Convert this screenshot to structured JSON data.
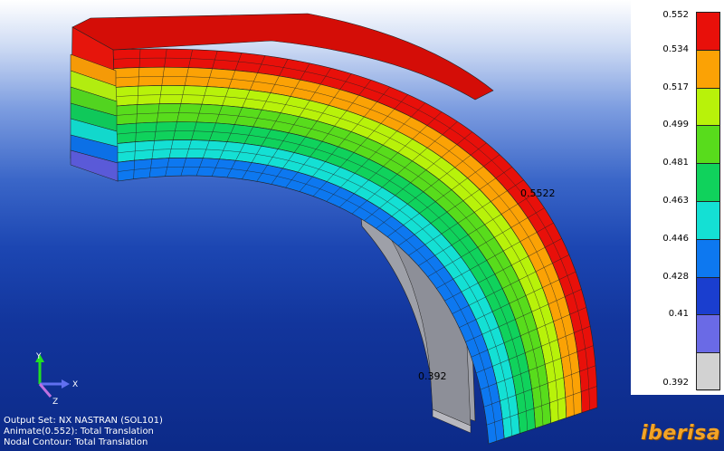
{
  "legend": {
    "values": [
      "0.552",
      "0.534",
      "0.517",
      "0.499",
      "0.481",
      "0.463",
      "0.446",
      "0.428",
      "0.41",
      "0.392"
    ],
    "colors": [
      "#e8100a",
      "#fba205",
      "#b8f20a",
      "#58dc1c",
      "#10d25c",
      "#14e0d4",
      "#0d78f0",
      "#1a3ecf",
      "#6a6ae6",
      "#d2d2d2"
    ]
  },
  "markers": {
    "max_label": "0.5522",
    "min_label": "0.392"
  },
  "triad": {
    "x": "X",
    "y": "Y",
    "z": "Z"
  },
  "info": {
    "output_set": "Output Set: NX NASTRAN (SOL101)",
    "animate": "Animate(0.552): Total Translation",
    "contour": "Nodal Contour: Total Translation"
  },
  "brand": {
    "name": "iberisa"
  },
  "model": {
    "layers_outer_to_inner": [
      "#e8100a",
      "#fba205",
      "#b8f20a",
      "#58dc1c",
      "#10d25c",
      "#14e0d4",
      "#0d78f0"
    ]
  }
}
